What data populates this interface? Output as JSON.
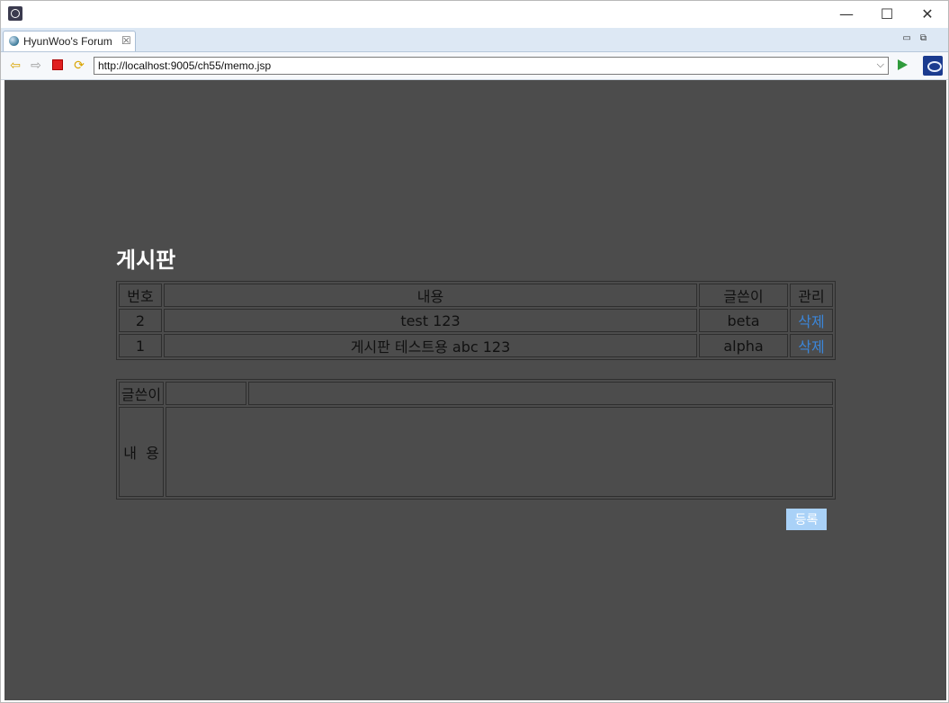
{
  "window": {
    "minimize": "—",
    "maximize": "☐",
    "close": "✕"
  },
  "tab": {
    "label": "HyunWoo's Forum",
    "close": "☒"
  },
  "toolbar": {
    "url": "http://localhost:9005/ch55/memo.jsp"
  },
  "page": {
    "title": "게시판",
    "list": {
      "headers": [
        "번호",
        "내용",
        "글쓴이",
        "관리"
      ],
      "rows": [
        {
          "no": "2",
          "content": "test 123",
          "writer": "beta",
          "action": "삭제"
        },
        {
          "no": "1",
          "content": "게시판 테스트용 abc 123",
          "writer": "alpha",
          "action": "삭제"
        }
      ]
    },
    "form": {
      "writer_label": "글쓴이",
      "content_label": "내  용",
      "submit": "등록"
    }
  }
}
